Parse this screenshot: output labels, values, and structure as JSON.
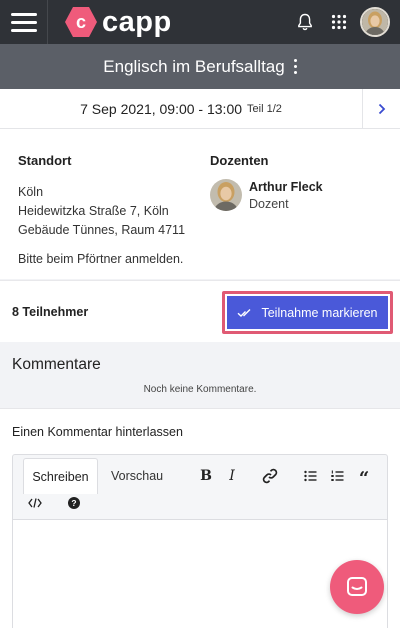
{
  "app": {
    "logo_text": "capp"
  },
  "course": {
    "title": "Englisch im Berufsalltag"
  },
  "session": {
    "date_time": "7 Sep 2021, 09:00 - 13:00",
    "part": "Teil 1/2"
  },
  "location": {
    "heading": "Standort",
    "lines": [
      "Köln",
      "Heidewitzka Straße 7, Köln",
      "Gebäude Tünnes, Raum 4711"
    ],
    "note": "Bitte beim Pförtner anmelden."
  },
  "lecturers": {
    "heading": "Dozenten",
    "items": [
      {
        "name": "Arthur Fleck",
        "role": "Dozent"
      }
    ]
  },
  "participants": {
    "count_label": "8 Teilnehmer",
    "mark_button": "Teilnahme markieren"
  },
  "comments": {
    "title": "Kommentare",
    "empty_text": "Noch keine Kommentare."
  },
  "editor": {
    "title": "Einen Kommentar hinterlassen",
    "tabs": [
      "Schreiben",
      "Vorschau"
    ],
    "active_tab": "Schreiben",
    "tools": [
      "bold",
      "italic",
      "link",
      "bullet-list",
      "numbered-list",
      "quote",
      "code",
      "help"
    ]
  },
  "colors": {
    "topbar": "#2f3237",
    "titlebar": "#5b5f67",
    "brand": "#ef5b7b",
    "primary_button": "#4a59d9",
    "highlight": "#e05a74"
  }
}
